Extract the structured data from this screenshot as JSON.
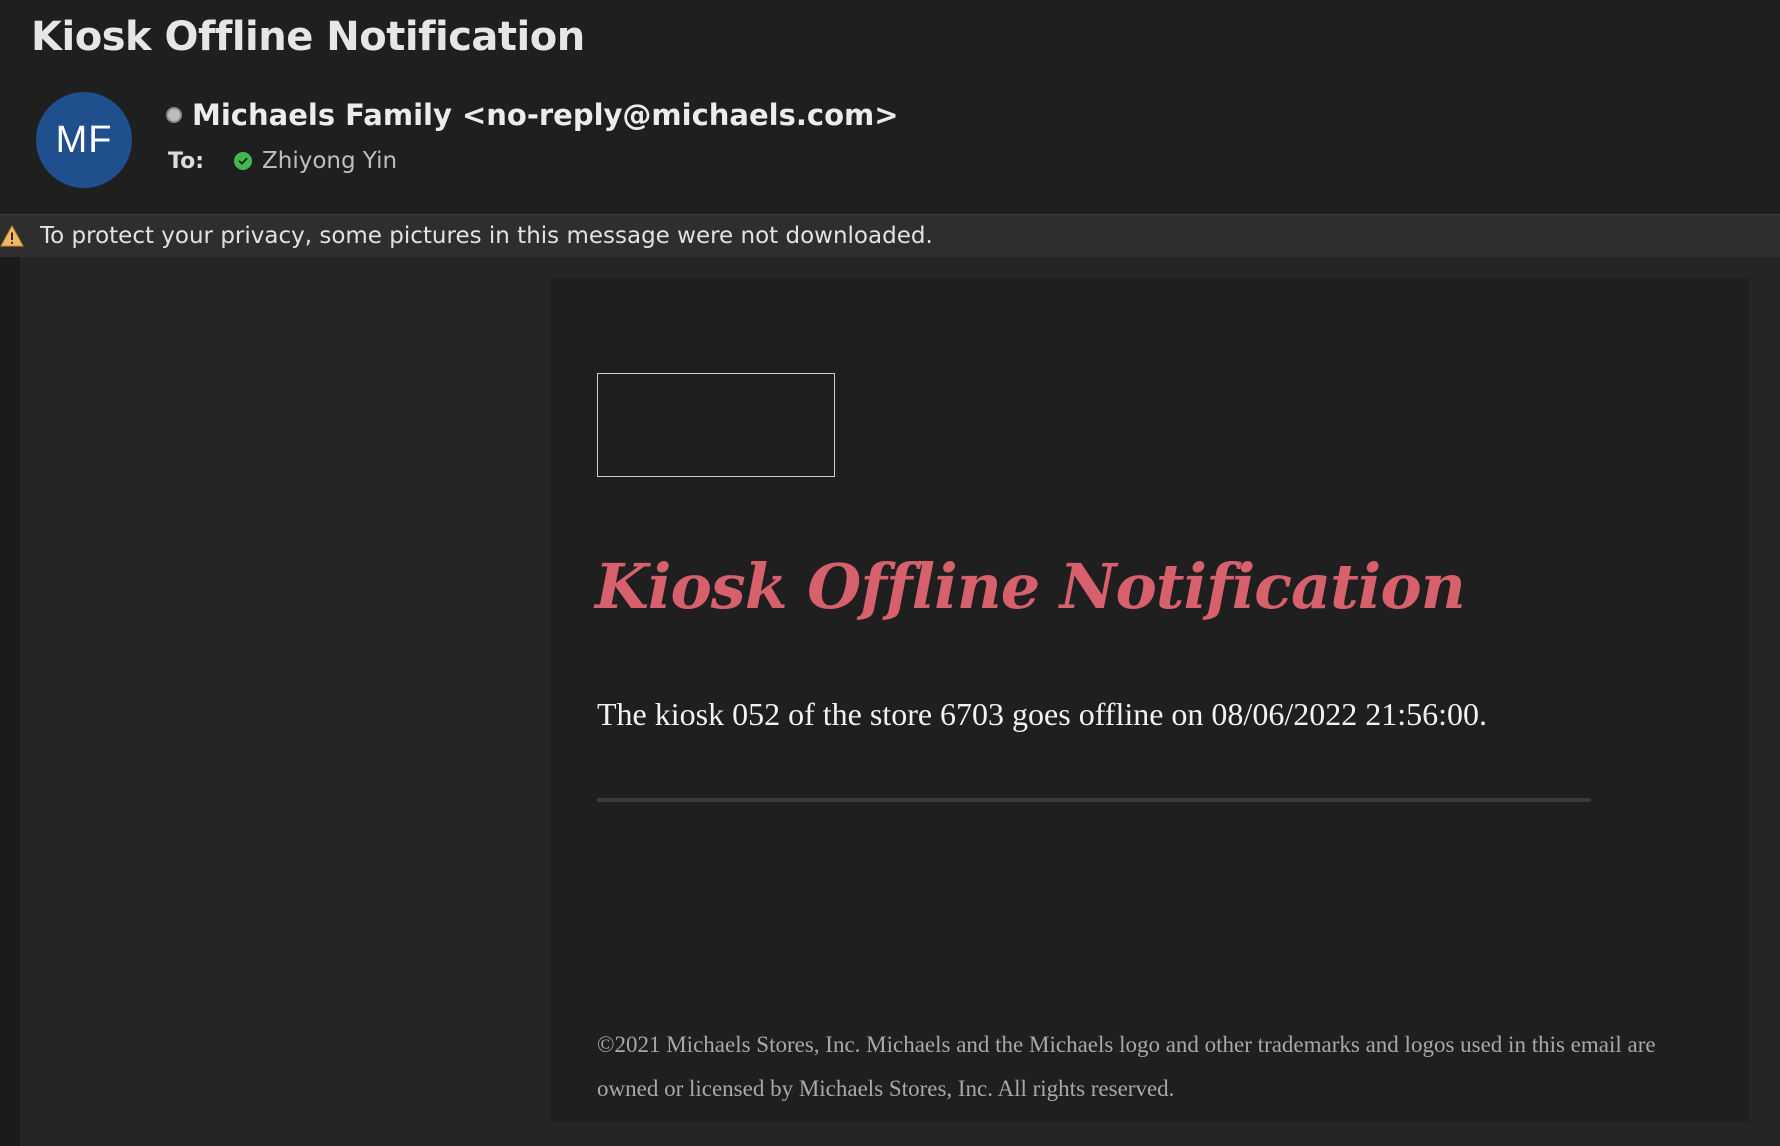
{
  "header": {
    "subject": "Kiosk Offline Notification",
    "avatar_initials": "MF",
    "avatar_color": "#1f4f8c",
    "sender": "Michaels Family <no-reply@michaels.com>",
    "to_label": "To:",
    "recipient": "Zhiyong Yin"
  },
  "privacy_bar": {
    "icon": "warning-icon",
    "text": "To protect your privacy, some pictures in this message were not downloaded."
  },
  "email": {
    "headline": "Kiosk Offline Notification",
    "headline_color": "#d7606d",
    "message": "The kiosk 052 of the store 6703 goes offline on 08/06/2022 21:56:00.",
    "footer": "©2021 Michaels Stores, Inc. Michaels and the Michaels logo and other trademarks and logos used in this email are owned or licensed by Michaels Stores, Inc. All rights reserved."
  }
}
